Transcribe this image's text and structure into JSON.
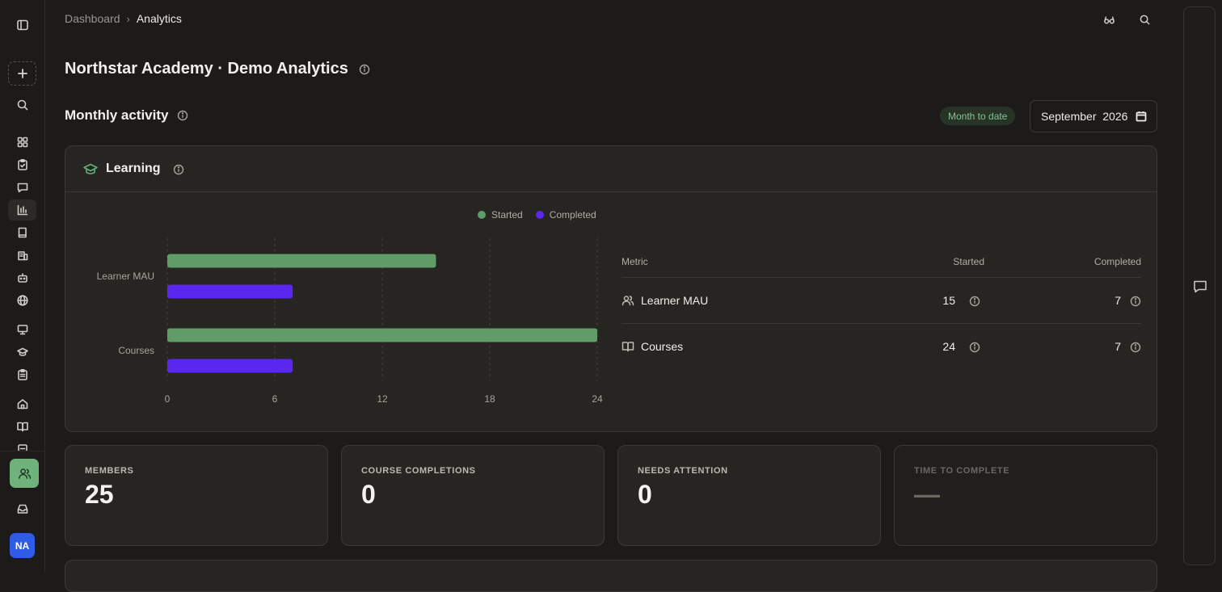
{
  "breadcrumb": {
    "parent": "Dashboard",
    "separator": "›",
    "current": "Analytics"
  },
  "page": {
    "title": "Northstar Academy · Demo Analytics"
  },
  "section": {
    "title": "Monthly activity",
    "badge": "Month to date",
    "month_value": "September  2026"
  },
  "learning_card": {
    "title": "Learning",
    "legend": [
      {
        "label": "Started",
        "color": "#5f9c68"
      },
      {
        "label": "Completed",
        "color": "#5a27f0"
      }
    ],
    "table": {
      "headers": {
        "metric": "Metric",
        "started": "Started",
        "completed": "Completed"
      },
      "rows": [
        {
          "icon": "users-icon",
          "label": "Learner MAU",
          "started": "15",
          "completed": "7"
        },
        {
          "icon": "book-open-icon",
          "label": "Courses",
          "started": "24",
          "completed": "7"
        }
      ]
    }
  },
  "chart_data": {
    "type": "bar",
    "orientation": "horizontal",
    "categories": [
      "Learner MAU",
      "Courses"
    ],
    "series": [
      {
        "name": "Started",
        "values": [
          15,
          24
        ],
        "color": "#5f9c68"
      },
      {
        "name": "Completed",
        "values": [
          7,
          7
        ],
        "color": "#5a27f0"
      }
    ],
    "xlim": [
      0,
      24
    ],
    "xticks": [
      "0",
      "6",
      "12",
      "18",
      "24"
    ],
    "legend": "top",
    "grid": "vertical dashed"
  },
  "stats": [
    {
      "label": "MEMBERS",
      "value": "25",
      "muted": false
    },
    {
      "label": "COURSE COMPLETIONS",
      "value": "0",
      "muted": false
    },
    {
      "label": "NEEDS ATTENTION",
      "value": "0",
      "muted": false
    },
    {
      "label": "TIME TO COMPLETE",
      "value": "—",
      "muted": true
    }
  ],
  "user": {
    "initials": "NA"
  },
  "colors": {
    "accent_green": "#6fb27c",
    "avatar_blue": "#2f5be6",
    "started": "#5f9c68",
    "completed": "#5a27f0"
  }
}
